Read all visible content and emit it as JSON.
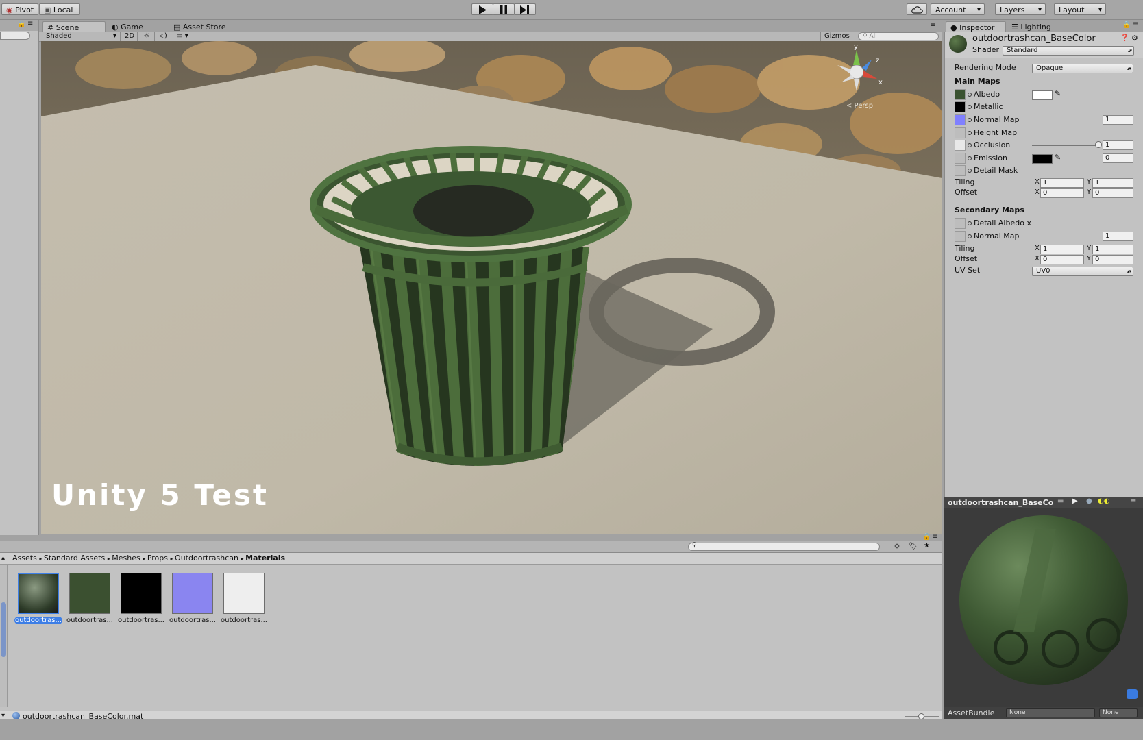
{
  "toolbar": {
    "pivot_label": "Pivot",
    "local_label": "Local",
    "account_label": "Account",
    "layers_label": "Layers",
    "layout_label": "Layout"
  },
  "scene_tabs": [
    {
      "label": "Scene"
    },
    {
      "label": "Game"
    },
    {
      "label": "Asset Store"
    }
  ],
  "scene_toolbar": {
    "shading_mode": "Shaded",
    "mode_2d": "2D",
    "gizmos_label": "Gizmos",
    "search_placeholder": "All"
  },
  "scene": {
    "overlay_text": "Unity 5 Test",
    "persp_label": "< Persp",
    "axis_y": "y",
    "axis_z": "z",
    "axis_x": "x"
  },
  "inspector_tabs": [
    {
      "label": "Inspector"
    },
    {
      "label": "Lighting"
    }
  ],
  "inspector": {
    "material_name": "outdoortrashcan_BaseColor",
    "shader_label": "Shader",
    "shader_value": "Standard",
    "rendering_mode_label": "Rendering Mode",
    "rendering_mode_value": "Opaque",
    "main_maps_title": "Main Maps",
    "albedo_label": "Albedo",
    "metallic_label": "Metallic",
    "normal_map_label": "Normal Map",
    "normal_map_value": "1",
    "height_map_label": "Height Map",
    "occlusion_label": "Occlusion",
    "occlusion_value": "1",
    "emission_label": "Emission",
    "emission_value": "0",
    "detail_mask_label": "Detail Mask",
    "tiling_label": "Tiling",
    "offset_label": "Offset",
    "x_label": "X",
    "y_label": "Y",
    "tiling_x": "1",
    "tiling_y": "1",
    "offset_x": "0",
    "offset_y": "0",
    "secondary_maps_title": "Secondary Maps",
    "detail_albedo_label": "Detail Albedo x",
    "secondary_normal_label": "Normal Map",
    "secondary_normal_value": "1",
    "sec_tiling_x": "1",
    "sec_tiling_y": "1",
    "sec_offset_x": "0",
    "sec_offset_y": "0",
    "uv_set_label": "UV Set",
    "uv_set_value": "UV0",
    "albedo_color": "#ffffff",
    "emission_color": "#000000"
  },
  "preview": {
    "title": "outdoortrashcan_BaseCo",
    "assetbundle_label": "AssetBundle",
    "assetbundle_value": "None",
    "variant_value": "None"
  },
  "project": {
    "breadcrumb": [
      "Assets",
      "Standard Assets",
      "Meshes",
      "Props",
      "Outdoortrashcan",
      "Materials"
    ],
    "items": [
      {
        "label": "outdoortras..."
      },
      {
        "label": "outdoortras..."
      },
      {
        "label": "outdoortras..."
      },
      {
        "label": "outdoortras..."
      },
      {
        "label": "outdoortras..."
      }
    ],
    "status_file": "outdoortrashcan_BaseColor.mat"
  },
  "colors": {
    "trashcan_green": "#3f5a32",
    "selection_blue": "#3d7ee6",
    "normal_map_blue": "#8080ff"
  }
}
